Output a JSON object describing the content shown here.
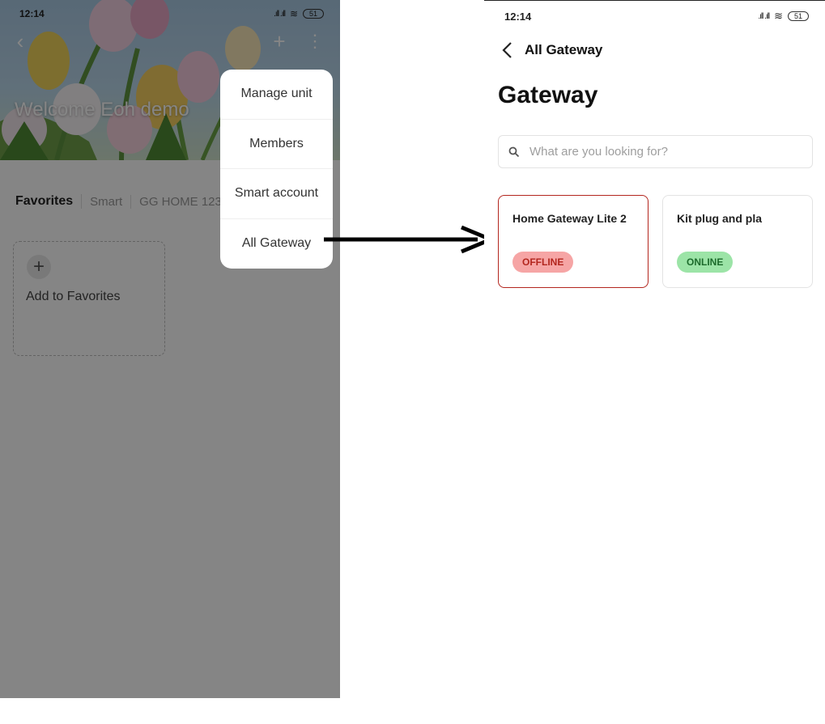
{
  "left_screen": {
    "status_bar": {
      "time": "12:14",
      "play_glyph": "⊳",
      "signal": ".ıll .ıll",
      "battery": "51"
    },
    "header": {
      "back_icon": "chevron-left-icon",
      "add_icon": "plus-sparkle-icon",
      "more_icon": "more-vertical-icon",
      "welcome": "Welcome Eoh demo"
    },
    "tabs": [
      "Favorites",
      "Smart",
      "GG HOME 123"
    ],
    "favorites_card": {
      "plus": "+",
      "label": "Add to Favorites"
    },
    "menu": {
      "items": [
        "Manage unit",
        "Members",
        "Smart account",
        "All Gateway"
      ]
    }
  },
  "right_screen": {
    "status_bar": {
      "time": "12:14",
      "play_glyph": "⊳",
      "signal": ".ıll .ıll",
      "battery": "51"
    },
    "header": {
      "back_glyph": "<",
      "title": "All Gateway"
    },
    "page_title": "Gateway",
    "search": {
      "placeholder": "What are you looking for?",
      "value": ""
    },
    "gateways": [
      {
        "name": "Home Gateway Lite 2",
        "status": "OFFLINE",
        "status_color": "#b3261e"
      },
      {
        "name": "Kit plug and pla",
        "status": "ONLINE",
        "status_color": "#1d6b2c"
      }
    ]
  },
  "colors": {
    "offline_border": "#b3261e",
    "offline_badge": "#f6a5a5",
    "online_badge": "#9ce4a7",
    "overlay": "rgba(0,0,0,0.48)"
  }
}
